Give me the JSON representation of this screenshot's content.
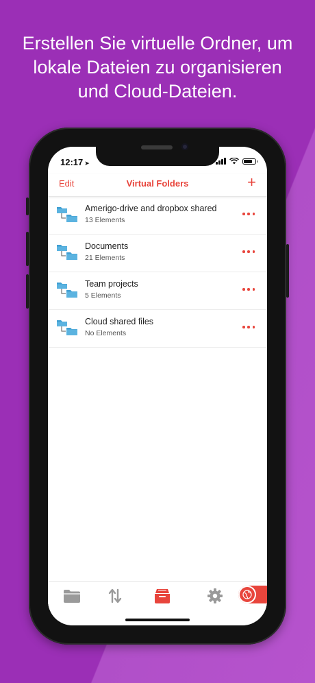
{
  "headline": {
    "line1": "Erstellen Sie virtuelle Ordner, um",
    "line2": "lokale Dateien zu organisieren",
    "line3": "und Cloud-Dateien."
  },
  "status_bar": {
    "time": "12:17"
  },
  "nav": {
    "edit_label": "Edit",
    "title": "Virtual Folders",
    "add_label": "+"
  },
  "folders": [
    {
      "name": "Amerigo-drive and dropbox shared",
      "count": "13 Elements"
    },
    {
      "name": "Documents",
      "count": "21 Elements"
    },
    {
      "name": "Team projects",
      "count": "5 Elements"
    },
    {
      "name": "Cloud shared files",
      "count": "No Elements"
    }
  ],
  "tabs": [
    {
      "icon": "folder-icon",
      "active": false
    },
    {
      "icon": "transfer-arrows-icon",
      "active": false
    },
    {
      "icon": "virtual-folders-box-icon",
      "active": true
    },
    {
      "icon": "gear-icon",
      "active": false
    },
    {
      "icon": "globe-icon",
      "active": false
    }
  ],
  "colors": {
    "accent": "#e8453c",
    "background": "#9b2fb6",
    "folder_blue": "#3f9fd2",
    "tab_inactive": "#9a9a9a"
  }
}
